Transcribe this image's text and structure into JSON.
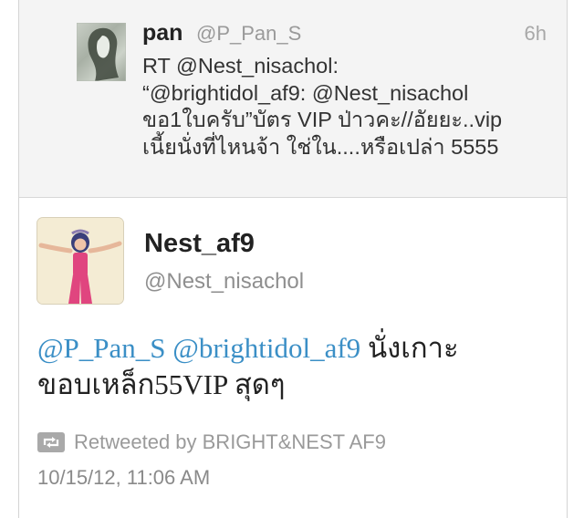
{
  "reply": {
    "name": "pan",
    "handle": "@P_Pan_S",
    "time": "6h",
    "lines": [
      "RT @Nest_nisachol:",
      "“@brightidol_af9: @Nest_nisachol",
      "ขอ1ใบครับ”บัตร VIP ป่าวคะ//อัยยะ..vip",
      "เนี้ยนั่งที่ไหนจ้า ใช่ใน....หรือเปล่า 5555"
    ]
  },
  "tweet": {
    "name": "Nest_af9",
    "handle": "@Nest_nisachol",
    "mention1": "@P_Pan_S",
    "mention2": "@brightidol_af9",
    "text_tail": " นั่งเกาะ",
    "line2": "ขอบเหล็ก55VIP สุดๆ",
    "retweeted_by": "Retweeted by BRIGHT&NEST AF9",
    "timestamp": "10/15/12, 11:06 AM"
  },
  "colors": {
    "mention": "#3b8fc6",
    "reply_bg": "#f4f4f4"
  },
  "icons": {
    "retweet": "retweet-icon"
  }
}
